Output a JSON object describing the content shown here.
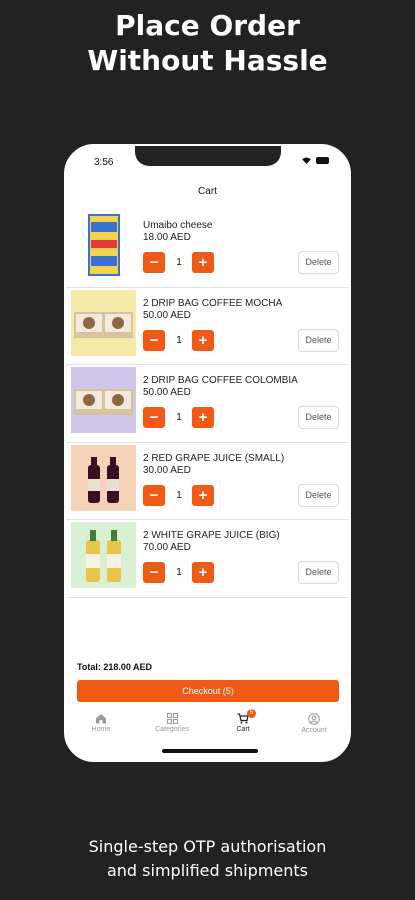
{
  "promo": {
    "headline_line1": "Place Order",
    "headline_line2": "Without Hassle",
    "caption_line1": "Single-step OTP authorisation",
    "caption_line2": "and simplified shipments"
  },
  "status_bar": {
    "time": "3:56"
  },
  "nav": {
    "title": "Cart"
  },
  "cart": {
    "delete_label": "Delete",
    "minus_label": "−",
    "plus_label": "+",
    "items": [
      {
        "name": "Umaibo cheese",
        "price": "18.00 AED",
        "qty": "1",
        "thumb_bg": "#ffffff"
      },
      {
        "name": "2 DRIP BAG COFFEE MOCHA",
        "price": "50.00 AED",
        "qty": "1",
        "thumb_bg": "#f4e9a6"
      },
      {
        "name": "2 DRIP BAG COFFEE COLOMBIA",
        "price": "50.00 AED",
        "qty": "1",
        "thumb_bg": "#cfc6ea"
      },
      {
        "name": "2 RED GRAPE JUICE (SMALL)",
        "price": "30.00 AED",
        "qty": "1",
        "thumb_bg": "#f6d3b7"
      },
      {
        "name": "2 WHITE GRAPE JUICE (BIG)",
        "price": "70.00 AED",
        "qty": "1",
        "thumb_bg": "#d9f0d3"
      }
    ],
    "total": "Total: 218.00 AED",
    "checkout_label": "Checkout (5)"
  },
  "tabbar": {
    "items": [
      {
        "label": "Home",
        "icon": "home-icon"
      },
      {
        "label": "Categories",
        "icon": "grid-icon"
      },
      {
        "label": "Cart",
        "icon": "cart-icon",
        "badge": "5",
        "active": true
      },
      {
        "label": "Account",
        "icon": "account-icon"
      }
    ]
  },
  "colors": {
    "accent": "#ef5a17",
    "background": "#222222"
  }
}
